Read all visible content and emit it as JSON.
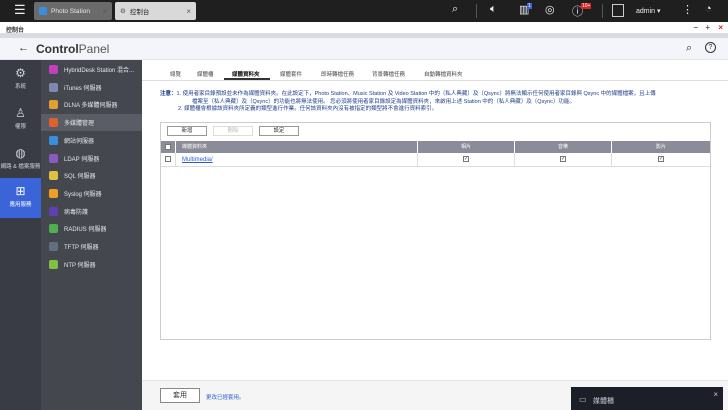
{
  "topbar": {
    "tabs": [
      {
        "label": "Photo Station",
        "close": "×"
      },
      {
        "label": "控制台",
        "close": "×"
      }
    ],
    "notification_badge": "1",
    "alert_badge": "10+",
    "user": "admin ▾"
  },
  "window": {
    "title": "控制台",
    "controls": [
      "−",
      "+",
      "×"
    ]
  },
  "header": {
    "back": "←",
    "title_bold": "Control",
    "title_light": "Panel"
  },
  "rail": [
    {
      "label": "系統",
      "icon": "gear-icon"
    },
    {
      "label": "權限",
      "icon": "user-icon"
    },
    {
      "label": "網路 & 檔案服務",
      "icon": "globe-icon"
    },
    {
      "label": "應用服務",
      "icon": "apps-icon",
      "selected": true
    }
  ],
  "menu": [
    {
      "label": "HybridDesk Station 混合...",
      "color": "#c040c0"
    },
    {
      "label": "iTunes 伺服器",
      "color": "#7c8ab0"
    },
    {
      "label": "DLNA 多媒體伺服器",
      "color": "#e0a030"
    },
    {
      "label": "多媒體管理",
      "color": "#e06030",
      "selected": true
    },
    {
      "label": "網站伺服器",
      "color": "#3a8ee0"
    },
    {
      "label": "LDAP 伺服器",
      "color": "#8a5ac0"
    },
    {
      "label": "SQL 伺服器",
      "color": "#e0c040"
    },
    {
      "label": "Syslog 伺服器",
      "color": "#f0a020"
    },
    {
      "label": "病毒防護",
      "color": "#6040b0"
    },
    {
      "label": "RADIUS 伺服器",
      "color": "#50b050"
    },
    {
      "label": "TFTP 伺服器",
      "color": "#607080"
    },
    {
      "label": "NTP 伺服器",
      "color": "#80c040"
    }
  ],
  "tabs": [
    "總覽",
    "媒體櫃",
    "媒體資料夾",
    "媒體套件",
    "即時轉檔任務",
    "背景轉檔任務",
    "自動轉檔資料夾"
  ],
  "active_tab": "媒體資料夾",
  "notes": {
    "prefix": "注意：",
    "line1": "1. 使用者家目錄預設並未作為媒體資料夾。在此設定下，Photo Station、Music Station 及 Video Station 中的〔私人典藏〕及〔Qsync〕將無法顯示任何使用者家目錄與 Qsync 中的媒體檔案，且上傳",
    "line1b": "檔案至〔私人典藏〕及〔Qsync〕的功能也將無法使用。 您必須將使用者家目錄設定為媒體資料夾，來啟用上述 Station 中的〔私人典藏〕及〔Qsync〕功能。",
    "line2": "2. 媒體櫃會根據該資料夾所定義的類型進行作業。任何該資料夾內沒有被指定的類型將不會進行資料索引。"
  },
  "buttons": {
    "add": "新增",
    "delete": "刪除",
    "settings": "設定"
  },
  "table": {
    "headers": [
      "媒體資料夾",
      "相片",
      "音樂",
      "影片"
    ],
    "rows": [
      {
        "folder": "Multimedia/",
        "photo": true,
        "music": true,
        "video": true
      }
    ]
  },
  "footer": {
    "apply": "套用",
    "message": "更改已經套用。"
  },
  "toast": {
    "label": "媒體櫃",
    "close": "×"
  }
}
